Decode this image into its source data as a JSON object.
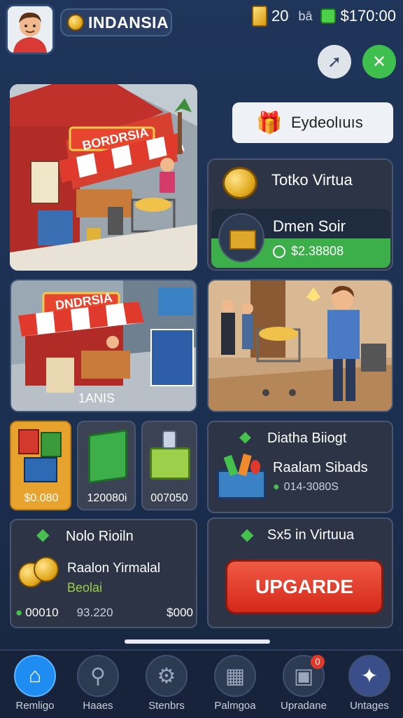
{
  "header": {
    "player_name": "INDANSIA",
    "gold_count": "20",
    "gold_suffix": "bā",
    "cash": "$170:00"
  },
  "buttons": {
    "pill_label": "Eydeolıuıs",
    "upgrade_label": "UPGARDE"
  },
  "store": {
    "sign": "BORDRSIA"
  },
  "toko_panel": {
    "title": "Totko Virtua",
    "sub_title": "Dmen Soir",
    "sub_value": "$2.38808"
  },
  "market": {
    "sign": "DNDRSIA",
    "caption": "1ANIS"
  },
  "tiles": [
    {
      "label": "$0.080"
    },
    {
      "label": "120080i"
    },
    {
      "label": "007050"
    }
  ],
  "diatha_panel": {
    "title": "Diatha Biiogt",
    "item": "Raalam Sibads",
    "value": "014-3080S"
  },
  "nolo_panel": {
    "title": "Nolo Rioiln",
    "line1": "Raalon Yirmalal",
    "line2": "Beolai",
    "stat1": "00010",
    "stat2": "93.220",
    "stat3": "$000"
  },
  "s_panel": {
    "title": "Sx5 in Virtuua"
  },
  "nav": [
    {
      "label": "Remligo",
      "icon": "home-icon"
    },
    {
      "label": "Haaes",
      "icon": "search-icon"
    },
    {
      "label": "Stenbrs",
      "icon": "gear-icon"
    },
    {
      "label": "Palmgoa",
      "icon": "shop-icon"
    },
    {
      "label": "Upradane",
      "icon": "image-icon",
      "badge": "0"
    },
    {
      "label": "Untages",
      "icon": "run-icon"
    }
  ],
  "colors": {
    "background": "#1f3559",
    "accent_green": "#3cae4a",
    "upgrade_red": "#e23a2a",
    "nav_active": "#1e8cf0"
  }
}
